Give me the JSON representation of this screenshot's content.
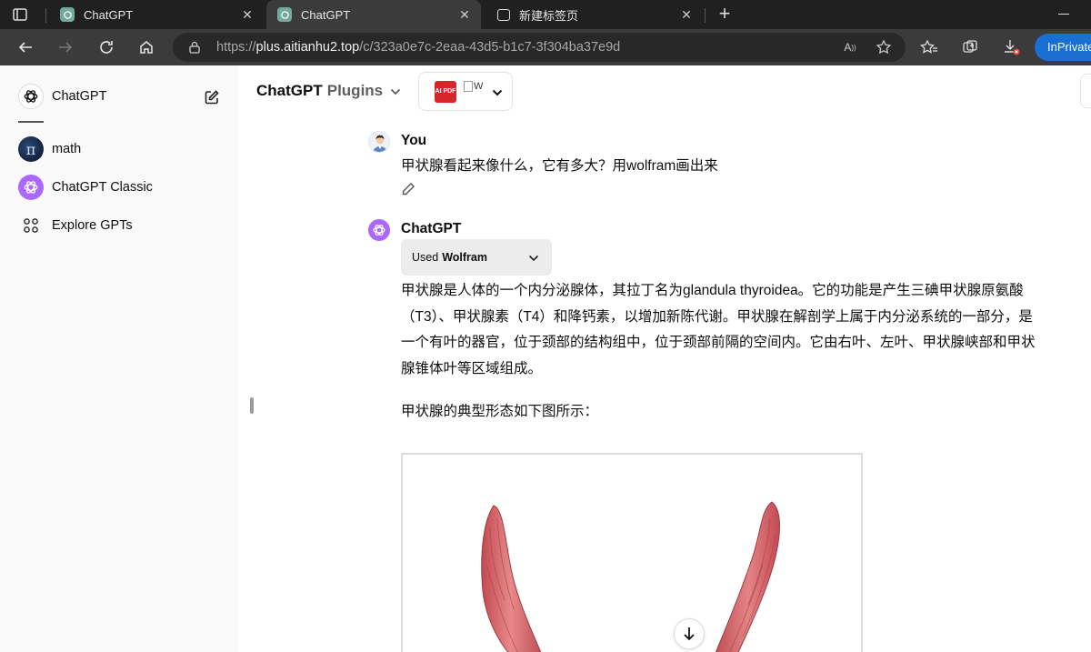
{
  "browser": {
    "tabs": [
      {
        "title": "ChatGPT"
      },
      {
        "title": "ChatGPT"
      },
      {
        "title": "新建标签页"
      }
    ],
    "url_prefix": "https://",
    "url_host": "plus.aitianhu2.top",
    "url_path": "/c/323a0e7c-2eaa-43d5-b1c7-3f304ba37e9d",
    "inprivate_label": "InPrivate",
    "accent_color": "#1a6fd2"
  },
  "sidebar": {
    "items": [
      {
        "label": "ChatGPT",
        "icon": "chatgpt-logo-icon"
      },
      {
        "label": "math",
        "icon": "math-avatar-icon"
      },
      {
        "label": "ChatGPT Classic",
        "icon": "chatgpt-classic-icon"
      },
      {
        "label": "Explore GPTs",
        "icon": "grid-icon"
      }
    ]
  },
  "header": {
    "model_name": "ChatGPT",
    "model_sub": "Plugins",
    "plugin_broken_alt": "W",
    "plugin_pdf_text": "AI PDF"
  },
  "conversation": {
    "user": {
      "author": "You",
      "text": "甲状腺看起来像什么，它有多大？用wolfram画出来"
    },
    "assistant": {
      "author": "ChatGPT",
      "tool_prefix": "Used",
      "tool_name": "Wolfram",
      "paragraph1": "甲状腺是人体的一个内分泌腺体，其拉丁名为glandula thyroidea。它的功能是产生三碘甲状腺原氨酸（T3）、甲状腺素（T4）和降钙素，以增加新陈代谢。甲状腺在解剖学上属于内分泌系统的一部分，是一个有叶的器官，位于颈部的结构组中，位于颈部前隔的空间内。它由右叶、左叶、甲状腺峡部和甲状腺锥体叶等区域组成。",
      "paragraph2": "甲状腺的典型形态如下图所示："
    }
  },
  "colors": {
    "sidebar_bg": "#f9f9f9",
    "gpt_purple": "#ab68ff",
    "thyroid_red": "#d9666a"
  }
}
